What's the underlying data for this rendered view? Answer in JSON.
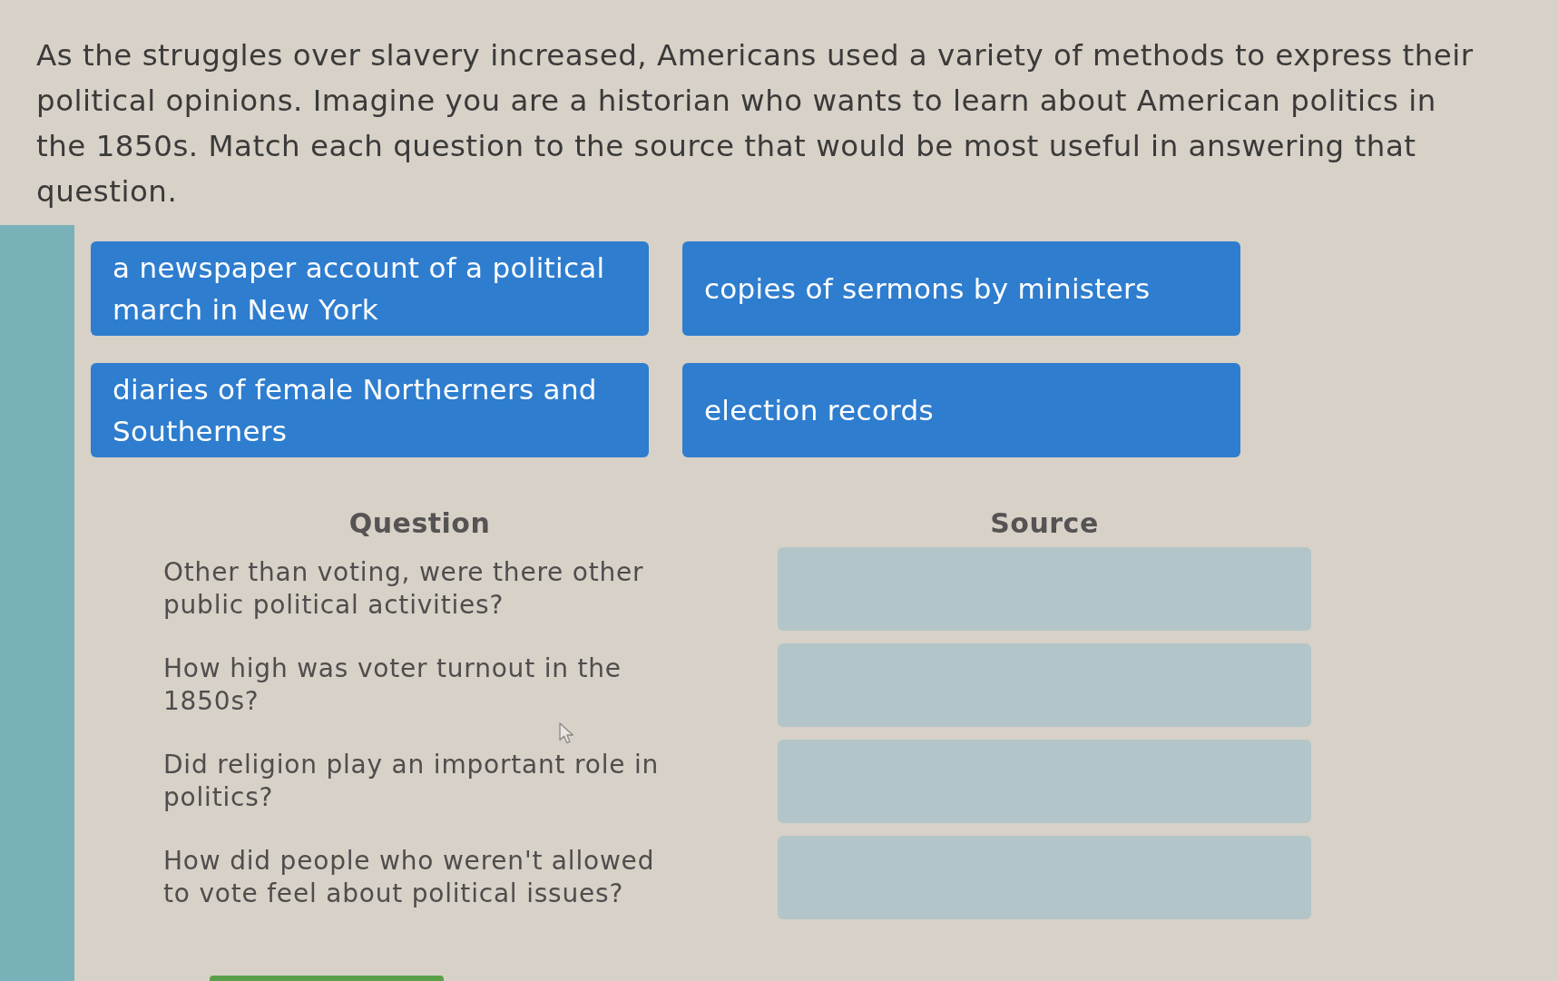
{
  "instructions": "As the struggles over slavery increased, Americans used a variety of methods to express their political opinions. Imagine you are a historian who wants to learn about American politics in the 1850s. Match each question to the source that would be most useful in answering that question.",
  "answer_choices": [
    {
      "text": "a newspaper account of a political march in New York"
    },
    {
      "text": "copies of sermons by ministers"
    },
    {
      "text": "diaries of female Northerners and Southerners"
    },
    {
      "text": "election records"
    }
  ],
  "headings": {
    "question": "Question",
    "source": "Source"
  },
  "rows": [
    {
      "question": "Other than voting, were there other public political activities?"
    },
    {
      "question": "How high was voter turnout in the 1850s?"
    },
    {
      "question": "Did religion play an important role in politics?"
    },
    {
      "question": "How did people who weren't allowed to vote feel about political issues?"
    }
  ]
}
